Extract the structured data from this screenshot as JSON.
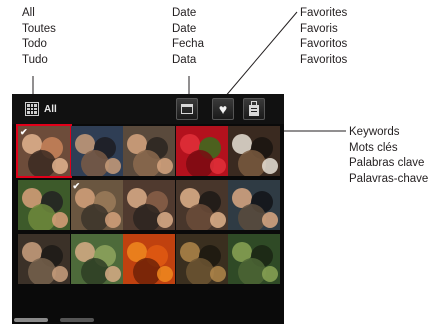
{
  "labels": {
    "all": [
      "All",
      "Toutes",
      "Todo",
      "Tudo"
    ],
    "date": [
      "Date",
      "Date",
      "Fecha",
      "Data"
    ],
    "favorites": [
      "Favorites",
      "Favoris",
      "Favoritos",
      "Favoritos"
    ],
    "keywords": [
      "Keywords",
      "Mots clés",
      "Palabras clave",
      "Palavras-chave"
    ]
  },
  "toolbar": {
    "all_label": "All",
    "date_icon": "calendar-icon",
    "favorites_icon": "heart-icon",
    "keywords_icon": "shopping-bag-icon"
  },
  "gallery": {
    "thumbnails": [
      {
        "subject": "couple",
        "selected": true,
        "checked": true
      },
      {
        "subject": "people"
      },
      {
        "subject": "crowd"
      },
      {
        "subject": "strawberries"
      },
      {
        "subject": "coffee-cup"
      },
      {
        "subject": "family"
      },
      {
        "subject": "people-group",
        "checked": true
      },
      {
        "subject": "group-selfie"
      },
      {
        "subject": "friends"
      },
      {
        "subject": "two-people"
      },
      {
        "subject": "person"
      },
      {
        "subject": "people-outdoors"
      },
      {
        "subject": "autumn-leaf"
      },
      {
        "subject": "food"
      },
      {
        "subject": "landscape"
      }
    ]
  },
  "colors": {
    "device_bg": "#0a0a0a",
    "selection": "#e1001a",
    "caption_text": "#231f20"
  }
}
